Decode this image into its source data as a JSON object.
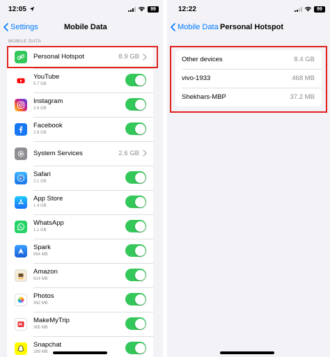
{
  "left": {
    "status": {
      "time": "12:05",
      "battery": "99"
    },
    "nav": {
      "back_label": "Settings",
      "title": "Mobile Data"
    },
    "section_label": "MOBILE DATA",
    "hotspot": {
      "label": "Personal Hotspot",
      "value": "8.9 GB"
    },
    "apps": [
      {
        "name": "YouTube",
        "size": "5.7 GB",
        "enabled": true,
        "icon": "youtube-icon",
        "color": "#ff0000"
      },
      {
        "name": "Instagram",
        "size": "2.6 GB",
        "enabled": true,
        "icon": "instagram-icon",
        "color": "#d6249f"
      },
      {
        "name": "Facebook",
        "size": "2.9 GB",
        "enabled": true,
        "icon": "facebook-icon",
        "color": "#1877f2"
      },
      {
        "name": "Safari",
        "size": "2.1 GB",
        "enabled": true,
        "icon": "safari-compass-icon",
        "color": "#1a8cff"
      },
      {
        "name": "App Store",
        "size": "1.4 GB",
        "enabled": true,
        "icon": "app-store-icon",
        "color": "#1e88ff"
      },
      {
        "name": "WhatsApp",
        "size": "1.1 GB",
        "enabled": true,
        "icon": "whatsapp-icon",
        "color": "#25d366"
      },
      {
        "name": "Spark",
        "size": "854 MB",
        "enabled": true,
        "icon": "spark-icon",
        "color": "#1c7cf2"
      },
      {
        "name": "Amazon",
        "size": "814 MB",
        "enabled": true,
        "icon": "amazon-icon",
        "color": "#f7f0e0"
      },
      {
        "name": "Photos",
        "size": "392 MB",
        "enabled": true,
        "icon": "photos-flower-icon",
        "color": "#ffffff"
      },
      {
        "name": "MakeMyTrip",
        "size": "365 MB",
        "enabled": true,
        "icon": "makemytrip-icon",
        "color": "#ffffff"
      },
      {
        "name": "Snapchat",
        "size": "289 MB",
        "enabled": true,
        "icon": "snapchat-ghost-icon",
        "color": "#fffc00"
      }
    ],
    "system_services": {
      "label": "System Services",
      "value": "2.6 GB",
      "icon": "gear-icon",
      "color": "#8e8e93"
    }
  },
  "right": {
    "status": {
      "time": "12:22",
      "battery": "99"
    },
    "nav": {
      "back_label": "Mobile Data",
      "title": "Personal Hotspot"
    },
    "devices": [
      {
        "name": "Other devices",
        "value": "8.4 GB"
      },
      {
        "name": "vivo-1933",
        "value": "468 MB"
      },
      {
        "name": "Shekhars-MBP",
        "value": "37.2 MB"
      }
    ]
  },
  "colors": {
    "accent": "#007aff",
    "toggle_on": "#34c759",
    "highlight": "#e0201b",
    "hotspot_icon": "#34c759"
  }
}
